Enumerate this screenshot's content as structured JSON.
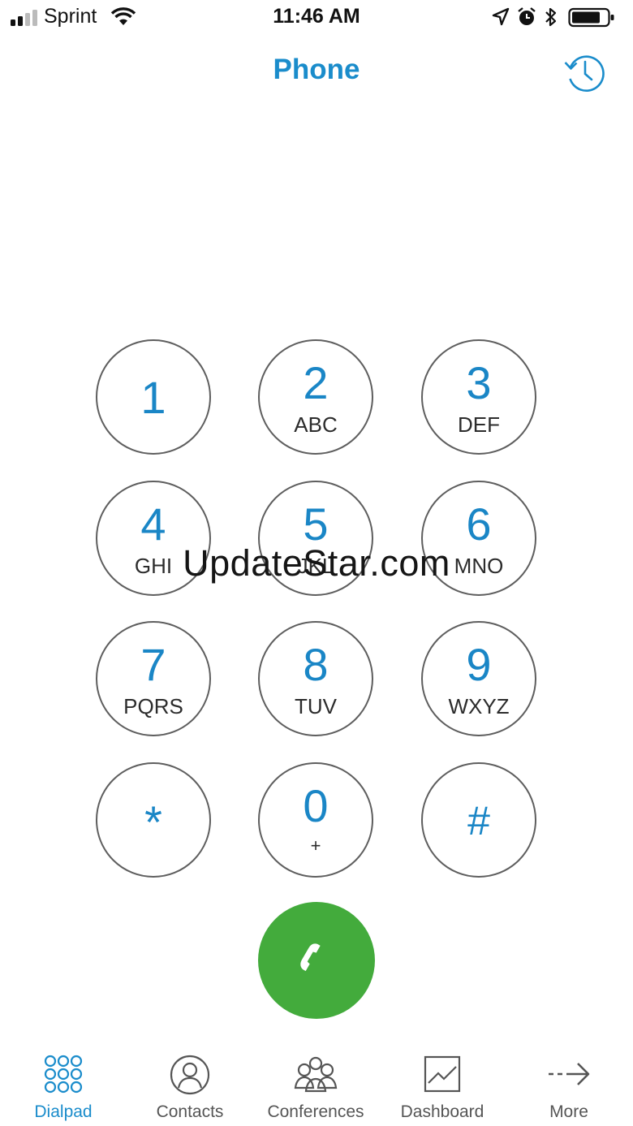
{
  "status_bar": {
    "carrier": "Sprint",
    "time": "11:46 AM"
  },
  "header": {
    "title": "Phone",
    "history_icon": "history-clock-icon"
  },
  "watermark": "UpdateStar.com",
  "keypad": {
    "keys": [
      {
        "digit": "1",
        "letters": ""
      },
      {
        "digit": "2",
        "letters": "ABC"
      },
      {
        "digit": "3",
        "letters": "DEF"
      },
      {
        "digit": "4",
        "letters": "GHI"
      },
      {
        "digit": "5",
        "letters": "JKL"
      },
      {
        "digit": "6",
        "letters": "MNO"
      },
      {
        "digit": "7",
        "letters": "PQRS"
      },
      {
        "digit": "8",
        "letters": "TUV"
      },
      {
        "digit": "9",
        "letters": "WXYZ"
      },
      {
        "digit": "*",
        "letters": ""
      },
      {
        "digit": "0",
        "letters": "+"
      },
      {
        "digit": "#",
        "letters": ""
      }
    ],
    "call_icon": "phone-handset-icon"
  },
  "tabs": [
    {
      "label": "Dialpad",
      "icon": "dialpad-icon",
      "active": true
    },
    {
      "label": "Contacts",
      "icon": "contact-icon",
      "active": false
    },
    {
      "label": "Conferences",
      "icon": "conference-icon",
      "active": false
    },
    {
      "label": "Dashboard",
      "icon": "dashboard-chart-icon",
      "active": false
    },
    {
      "label": "More",
      "icon": "arrow-more-icon",
      "active": false
    }
  ],
  "colors": {
    "accent": "#1a8ccb",
    "call_green": "#43ab3c",
    "key_border": "#5e5e5e"
  }
}
